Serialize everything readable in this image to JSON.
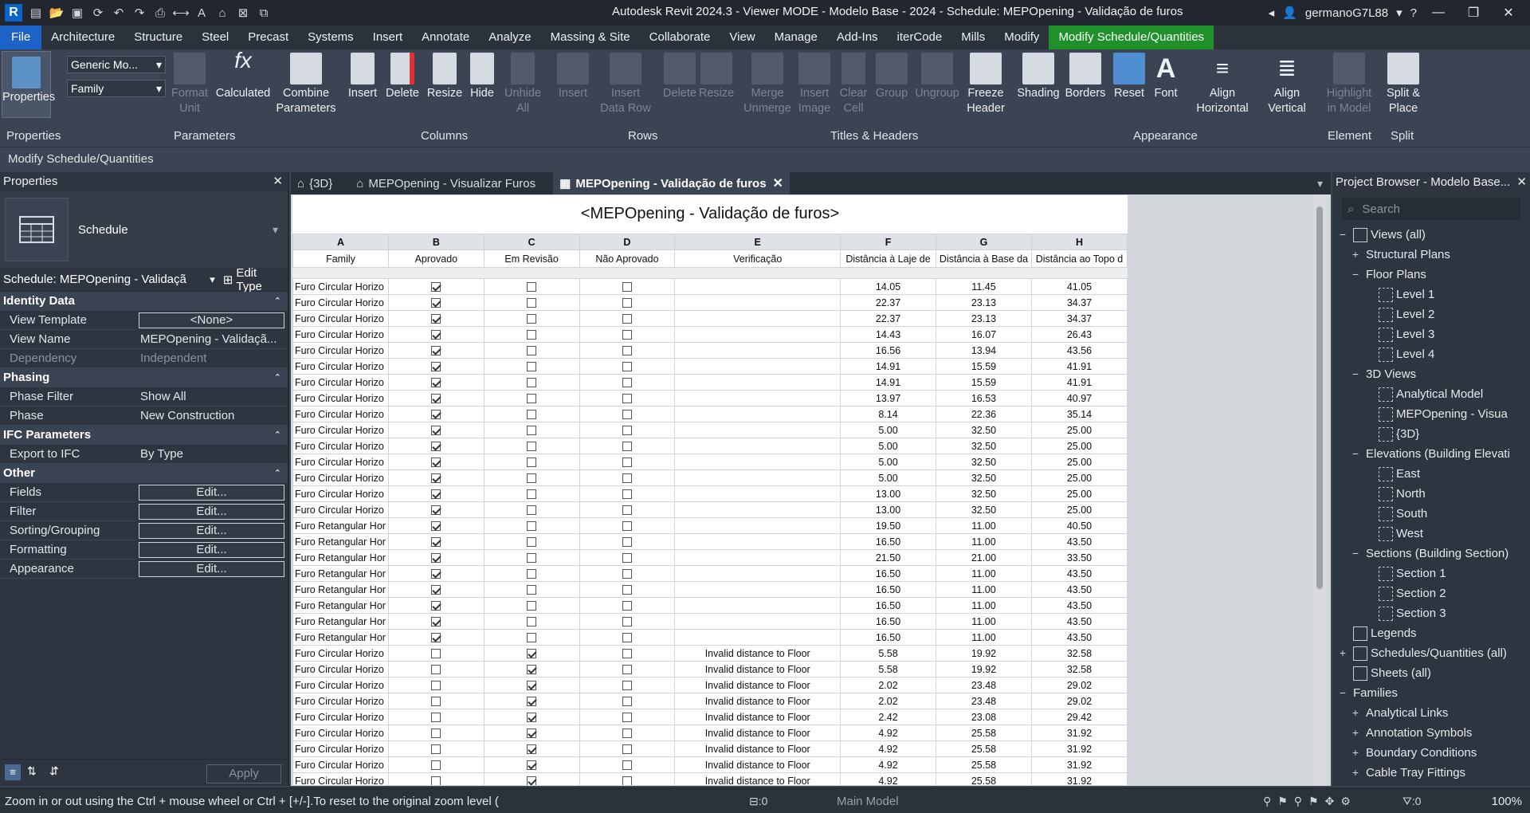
{
  "title": "Autodesk Revit 2024.3 - Viewer MODE - Modelo Base - 2024 - Schedule: MEPOpening - Validação de furos",
  "user": "germanoG7L88",
  "menu": [
    "File",
    "Architecture",
    "Structure",
    "Steel",
    "Precast",
    "Systems",
    "Insert",
    "Annotate",
    "Analyze",
    "Massing & Site",
    "Collaborate",
    "View",
    "Manage",
    "Add-Ins",
    "iterCode",
    "Mills",
    "Modify",
    "Modify Schedule/Quantities"
  ],
  "ribbon": {
    "properties": "Properties",
    "type_dropdown1": "Generic Mo...",
    "type_dropdown2": "Family",
    "buttons": {
      "format_unit": "Format\nUnit",
      "calculated": "Calculated",
      "combine": "Combine\nParameters",
      "insert": "Insert",
      "delete": "Delete",
      "resize": "Resize",
      "hide": "Hide",
      "unhide": "Unhide\nAll",
      "row_insert": "Insert",
      "insert_data_row": "Insert\nData Row",
      "row_delete": "Delete",
      "row_resize": "Resize",
      "merge": "Merge\nUnmerge",
      "insert_image": "Insert\nImage",
      "clear_cell": "Clear\nCell",
      "group": "Group",
      "ungroup": "Ungroup",
      "freeze": "Freeze\nHeader",
      "shading": "Shading",
      "borders": "Borders",
      "reset": "Reset",
      "font": "Font",
      "align_h": "Align\nHorizontal",
      "align_v": "Align\nVertical",
      "highlight": "Highlight\nin Model",
      "split": "Split &\nPlace"
    },
    "groups": [
      "Properties",
      "Parameters",
      "Columns",
      "Rows",
      "Titles & Headers",
      "Appearance",
      "Element",
      "Split"
    ]
  },
  "context_label": "Modify Schedule/Quantities",
  "properties_panel": {
    "header": "Properties",
    "type_name": "Schedule",
    "selector": "Schedule: MEPOpening - Validaçã",
    "edit_type": "Edit Type",
    "categories": [
      {
        "name": "Identity Data",
        "rows": [
          [
            "View Template",
            "<None>",
            "box"
          ],
          [
            "View Name",
            "MEPOpening - Validaçã...",
            ""
          ],
          [
            "Dependency",
            "Independent",
            "grey"
          ]
        ]
      },
      {
        "name": "Phasing",
        "rows": [
          [
            "Phase Filter",
            "Show All",
            ""
          ],
          [
            "Phase",
            "New Construction",
            ""
          ]
        ]
      },
      {
        "name": "IFC Parameters",
        "rows": [
          [
            "Export to IFC",
            "By Type",
            ""
          ]
        ]
      },
      {
        "name": "Other",
        "rows": [
          [
            "Fields",
            "Edit...",
            "box"
          ],
          [
            "Filter",
            "Edit...",
            "box"
          ],
          [
            "Sorting/Grouping",
            "Edit...",
            "box"
          ],
          [
            "Formatting",
            "Edit...",
            "box"
          ],
          [
            "Appearance",
            "Edit...",
            "box"
          ]
        ]
      }
    ],
    "apply": "Apply"
  },
  "tabs": [
    {
      "label": "{3D}",
      "active": false
    },
    {
      "label": "MEPOpening - Visualizar Furos",
      "active": false
    },
    {
      "label": "MEPOpening - Validação de furos",
      "active": true
    }
  ],
  "schedule": {
    "title": "<MEPOpening - Validação de furos>",
    "letters": [
      "A",
      "B",
      "C",
      "D",
      "E",
      "F",
      "G",
      "H"
    ],
    "headers": [
      "Family",
      "Aprovado",
      "Em Revisão",
      "Não Aprovado",
      "Verificação",
      "Distância à Laje de",
      "Distância à Base da",
      "Distância ao Topo d"
    ],
    "rows": [
      [
        "Furo Circular Horizo",
        1,
        0,
        0,
        "",
        "14.05",
        "11.45",
        "41.05"
      ],
      [
        "Furo Circular Horizo",
        1,
        0,
        0,
        "",
        "22.37",
        "23.13",
        "34.37"
      ],
      [
        "Furo Circular Horizo",
        1,
        0,
        0,
        "",
        "22.37",
        "23.13",
        "34.37"
      ],
      [
        "Furo Circular Horizo",
        1,
        0,
        0,
        "",
        "14.43",
        "16.07",
        "26.43"
      ],
      [
        "Furo Circular Horizo",
        1,
        0,
        0,
        "",
        "16.56",
        "13.94",
        "43.56"
      ],
      [
        "Furo Circular Horizo",
        1,
        0,
        0,
        "",
        "14.91",
        "15.59",
        "41.91"
      ],
      [
        "Furo Circular Horizo",
        1,
        0,
        0,
        "",
        "14.91",
        "15.59",
        "41.91"
      ],
      [
        "Furo Circular Horizo",
        1,
        0,
        0,
        "",
        "13.97",
        "16.53",
        "40.97"
      ],
      [
        "Furo Circular Horizo",
        1,
        0,
        0,
        "",
        "8.14",
        "22.36",
        "35.14"
      ],
      [
        "Furo Circular Horizo",
        1,
        0,
        0,
        "",
        "5.00",
        "32.50",
        "25.00"
      ],
      [
        "Furo Circular Horizo",
        1,
        0,
        0,
        "",
        "5.00",
        "32.50",
        "25.00"
      ],
      [
        "Furo Circular Horizo",
        1,
        0,
        0,
        "",
        "5.00",
        "32.50",
        "25.00"
      ],
      [
        "Furo Circular Horizo",
        1,
        0,
        0,
        "",
        "5.00",
        "32.50",
        "25.00"
      ],
      [
        "Furo Circular Horizo",
        1,
        0,
        0,
        "",
        "13.00",
        "32.50",
        "25.00"
      ],
      [
        "Furo Circular Horizo",
        1,
        0,
        0,
        "",
        "13.00",
        "32.50",
        "25.00"
      ],
      [
        "Furo Retangular Hor",
        1,
        0,
        0,
        "",
        "19.50",
        "11.00",
        "40.50"
      ],
      [
        "Furo Retangular Hor",
        1,
        0,
        0,
        "",
        "16.50",
        "11.00",
        "43.50"
      ],
      [
        "Furo Retangular Hor",
        1,
        0,
        0,
        "",
        "21.50",
        "21.00",
        "33.50"
      ],
      [
        "Furo Retangular Hor",
        1,
        0,
        0,
        "",
        "16.50",
        "11.00",
        "43.50"
      ],
      [
        "Furo Retangular Hor",
        1,
        0,
        0,
        "",
        "16.50",
        "11.00",
        "43.50"
      ],
      [
        "Furo Retangular Hor",
        1,
        0,
        0,
        "",
        "16.50",
        "11.00",
        "43.50"
      ],
      [
        "Furo Retangular Hor",
        1,
        0,
        0,
        "",
        "16.50",
        "11.00",
        "43.50"
      ],
      [
        "Furo Retangular Hor",
        1,
        0,
        0,
        "",
        "16.50",
        "11.00",
        "43.50"
      ],
      [
        "Furo Circular Horizo",
        0,
        1,
        0,
        "Invalid distance to Floor",
        "5.58",
        "19.92",
        "32.58"
      ],
      [
        "Furo Circular Horizo",
        0,
        1,
        0,
        "Invalid distance to Floor",
        "5.58",
        "19.92",
        "32.58"
      ],
      [
        "Furo Circular Horizo",
        0,
        1,
        0,
        "Invalid distance to Floor",
        "2.02",
        "23.48",
        "29.02"
      ],
      [
        "Furo Circular Horizo",
        0,
        1,
        0,
        "Invalid distance to Floor",
        "2.02",
        "23.48",
        "29.02"
      ],
      [
        "Furo Circular Horizo",
        0,
        1,
        0,
        "Invalid distance to Floor",
        "2.42",
        "23.08",
        "29.42"
      ],
      [
        "Furo Circular Horizo",
        0,
        1,
        0,
        "Invalid distance to Floor",
        "4.92",
        "25.58",
        "31.92"
      ],
      [
        "Furo Circular Horizo",
        0,
        1,
        0,
        "Invalid distance to Floor",
        "4.92",
        "25.58",
        "31.92"
      ],
      [
        "Furo Circular Horizo",
        0,
        1,
        0,
        "Invalid distance to Floor",
        "4.92",
        "25.58",
        "31.92"
      ],
      [
        "Furo Circular Horizo",
        0,
        1,
        0,
        "Invalid distance to Floor",
        "4.92",
        "25.58",
        "31.92"
      ]
    ]
  },
  "browser": {
    "header": "Project Browser - Modelo Base...",
    "search_placeholder": "Search",
    "items": [
      {
        "label": "Views (all)",
        "toggle": "−",
        "indent": 0,
        "icon": "views"
      },
      {
        "label": "Structural Plans",
        "toggle": "+",
        "indent": 1,
        "icon": ""
      },
      {
        "label": "Floor Plans",
        "toggle": "−",
        "indent": 1,
        "icon": ""
      },
      {
        "label": "Level 1",
        "toggle": "",
        "indent": 2,
        "icon": "view"
      },
      {
        "label": "Level 2",
        "toggle": "",
        "indent": 2,
        "icon": "view"
      },
      {
        "label": "Level 3",
        "toggle": "",
        "indent": 2,
        "icon": "view"
      },
      {
        "label": "Level 4",
        "toggle": "",
        "indent": 2,
        "icon": "view"
      },
      {
        "label": "3D Views",
        "toggle": "−",
        "indent": 1,
        "icon": ""
      },
      {
        "label": "Analytical Model",
        "toggle": "",
        "indent": 2,
        "icon": "view"
      },
      {
        "label": "MEPOpening - Visua",
        "toggle": "",
        "indent": 2,
        "icon": "view"
      },
      {
        "label": "{3D}",
        "toggle": "",
        "indent": 2,
        "icon": "view"
      },
      {
        "label": "Elevations (Building Elevati",
        "toggle": "−",
        "indent": 1,
        "icon": ""
      },
      {
        "label": "East",
        "toggle": "",
        "indent": 2,
        "icon": "view"
      },
      {
        "label": "North",
        "toggle": "",
        "indent": 2,
        "icon": "view"
      },
      {
        "label": "South",
        "toggle": "",
        "indent": 2,
        "icon": "view"
      },
      {
        "label": "West",
        "toggle": "",
        "indent": 2,
        "icon": "view"
      },
      {
        "label": "Sections (Building Section)",
        "toggle": "−",
        "indent": 1,
        "icon": ""
      },
      {
        "label": "Section 1",
        "toggle": "",
        "indent": 2,
        "icon": "view"
      },
      {
        "label": "Section 2",
        "toggle": "",
        "indent": 2,
        "icon": "view"
      },
      {
        "label": "Section 3",
        "toggle": "",
        "indent": 2,
        "icon": "view"
      },
      {
        "label": "Legends",
        "toggle": "",
        "indent": 0,
        "icon": "legend"
      },
      {
        "label": "Schedules/Quantities (all)",
        "toggle": "+",
        "indent": 0,
        "icon": "schedule"
      },
      {
        "label": "Sheets (all)",
        "toggle": "",
        "indent": 0,
        "icon": "sheet"
      },
      {
        "label": "Families",
        "toggle": "−",
        "indent": 0,
        "icon": ""
      },
      {
        "label": "Analytical Links",
        "toggle": "+",
        "indent": 1,
        "icon": ""
      },
      {
        "label": "Annotation Symbols",
        "toggle": "+",
        "indent": 1,
        "icon": ""
      },
      {
        "label": "Boundary Conditions",
        "toggle": "+",
        "indent": 1,
        "icon": ""
      },
      {
        "label": "Cable Tray Fittings",
        "toggle": "+",
        "indent": 1,
        "icon": ""
      }
    ]
  },
  "status": {
    "message": "Zoom in or out using the Ctrl + mouse wheel or Ctrl + [+/-].To reset to the original zoom level (",
    "worksets": ":0",
    "model": "Main Model",
    "filter_count": ":0",
    "zoom": "100%"
  }
}
